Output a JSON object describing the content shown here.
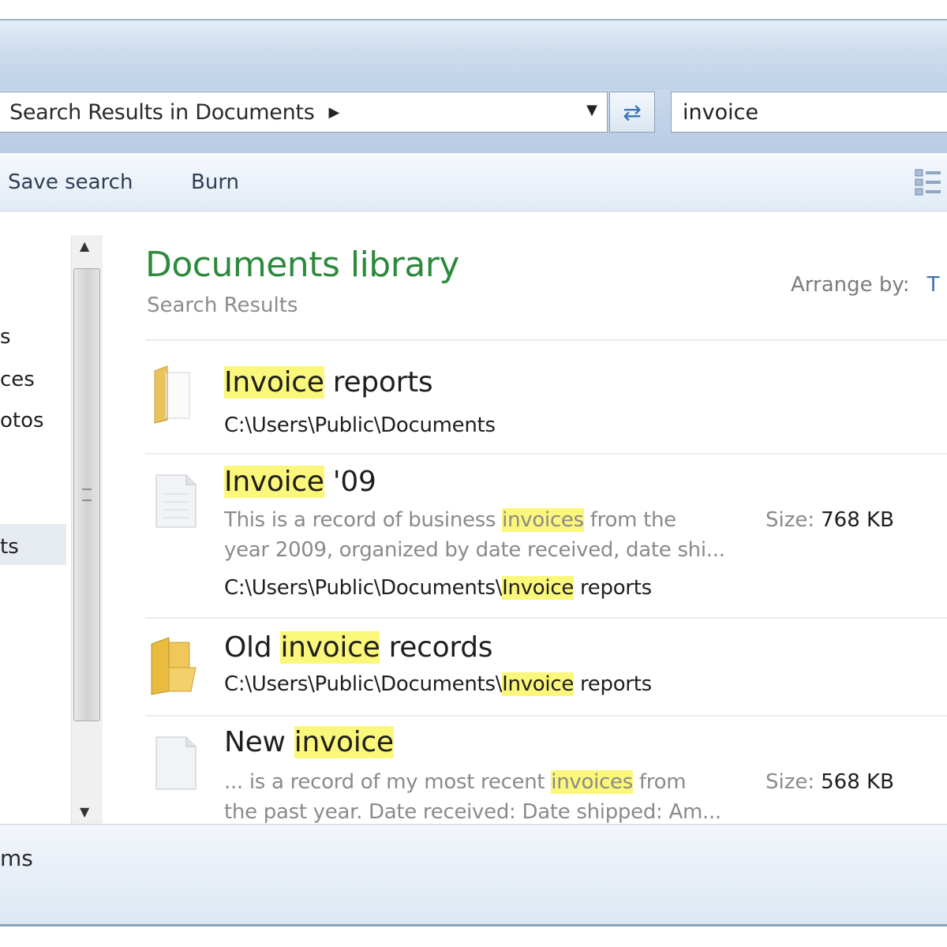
{
  "address": {
    "breadcrumb": "Search Results in Documents",
    "search_value": "invoice"
  },
  "toolbar": {
    "save_search": "Save search",
    "burn": "Burn"
  },
  "nav": {
    "items": [
      "s",
      "ces",
      "otos",
      "ts"
    ]
  },
  "library": {
    "title": "Documents library",
    "subtitle": "Search Results",
    "arrange_label": "Arrange by:",
    "arrange_value": "T"
  },
  "results": [
    {
      "icon": "folder-icon",
      "name_pre": "",
      "name_hl": "Invoice",
      "name_post": " reports",
      "path_pre": "C:\\Users\\Public\\Documents",
      "path_hl": "",
      "path_post": ""
    },
    {
      "icon": "document-icon",
      "name_pre": "",
      "name_hl": "Invoice",
      "name_post": " '09",
      "desc1_pre": "This is a record of business ",
      "desc1_hl": "invoices",
      "desc1_post": " from the",
      "desc2": "year 2009, organized by date received, date shi...",
      "path_pre": "C:\\Users\\Public\\Documents\\",
      "path_hl": "Invoice",
      "path_post": " reports",
      "size_label": "Size:",
      "size_value": "768 KB"
    },
    {
      "icon": "folder-icon",
      "name_pre": "Old ",
      "name_hl": "invoice",
      "name_post": " records",
      "path_pre": "C:\\Users\\Public\\Documents\\",
      "path_hl": "Invoice",
      "path_post": " reports"
    },
    {
      "icon": "document-icon",
      "name_pre": "New ",
      "name_hl": "invoice",
      "name_post": "",
      "desc1_pre": "... is a record of my most recent ",
      "desc1_hl": "invoices",
      "desc1_post": " from",
      "desc2": "the past year. Date received: Date shipped: Am...",
      "size_label": "Size:",
      "size_value": "568 KB"
    }
  ],
  "status": {
    "text": "ms"
  },
  "colors": {
    "library_title": "#2c8a3c",
    "highlight": "#fbf77a"
  }
}
